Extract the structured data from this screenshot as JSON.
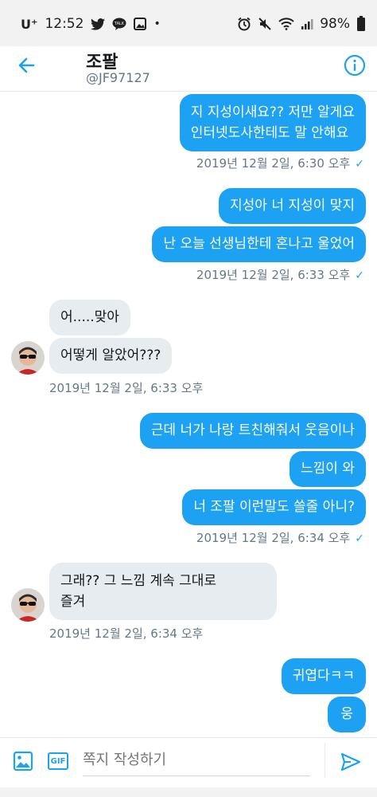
{
  "status_bar": {
    "carrier": "U⁺",
    "time": "12:52",
    "talk_icon_text": "TALK",
    "battery": "98%"
  },
  "header": {
    "name": "조팔",
    "handle": "@JF97127"
  },
  "messages": [
    {
      "id": "m1",
      "text_lines": [
        "지 지성이새요?? 저만 알게요",
        "인터넷도사한테도 말 안해요"
      ]
    },
    {
      "id": "m1_time",
      "text": "2019년 12월 2일, 6:30 오후"
    },
    {
      "id": "m2",
      "text": "지성아 너 지성이 맞지"
    },
    {
      "id": "m3",
      "text": "난 오늘 선생님한테 혼나고 울었어"
    },
    {
      "id": "m3_time",
      "text": "2019년 12월 2일, 6:33 오후"
    },
    {
      "id": "m4",
      "text": "어.....맞아"
    },
    {
      "id": "m5",
      "text": "어떻게 알았어???"
    },
    {
      "id": "m5_time",
      "text": "2019년 12월 2일, 6:33 오후"
    },
    {
      "id": "m6",
      "text": "근데 너가 나랑 트친해줘서 웃음이나"
    },
    {
      "id": "m7",
      "text": "느낌이 와"
    },
    {
      "id": "m8",
      "text": "너 조팔 이런말도 쓸줄 아니?"
    },
    {
      "id": "m8_time",
      "text": "2019년 12월 2일, 6:34 오후"
    },
    {
      "id": "m9",
      "text_lines": [
        "그래?? 그 느낌 계속 그대로",
        "즐겨"
      ]
    },
    {
      "id": "m9_time",
      "text": "2019년 12월 2일, 6:34 오후"
    },
    {
      "id": "m10",
      "text": "귀엽다ㅋㅋ"
    },
    {
      "id": "m11",
      "text": "웅"
    }
  ],
  "composer": {
    "placeholder": "쪽지 작성하기",
    "gif_label": "GIF"
  },
  "colors": {
    "accent": "#1da1f2",
    "incoming_bubble": "#e6ecf0",
    "meta_text": "#657786"
  },
  "icons": {
    "back": "arrow-left-icon",
    "info": "info-icon",
    "image": "image-icon",
    "send": "send-icon"
  }
}
